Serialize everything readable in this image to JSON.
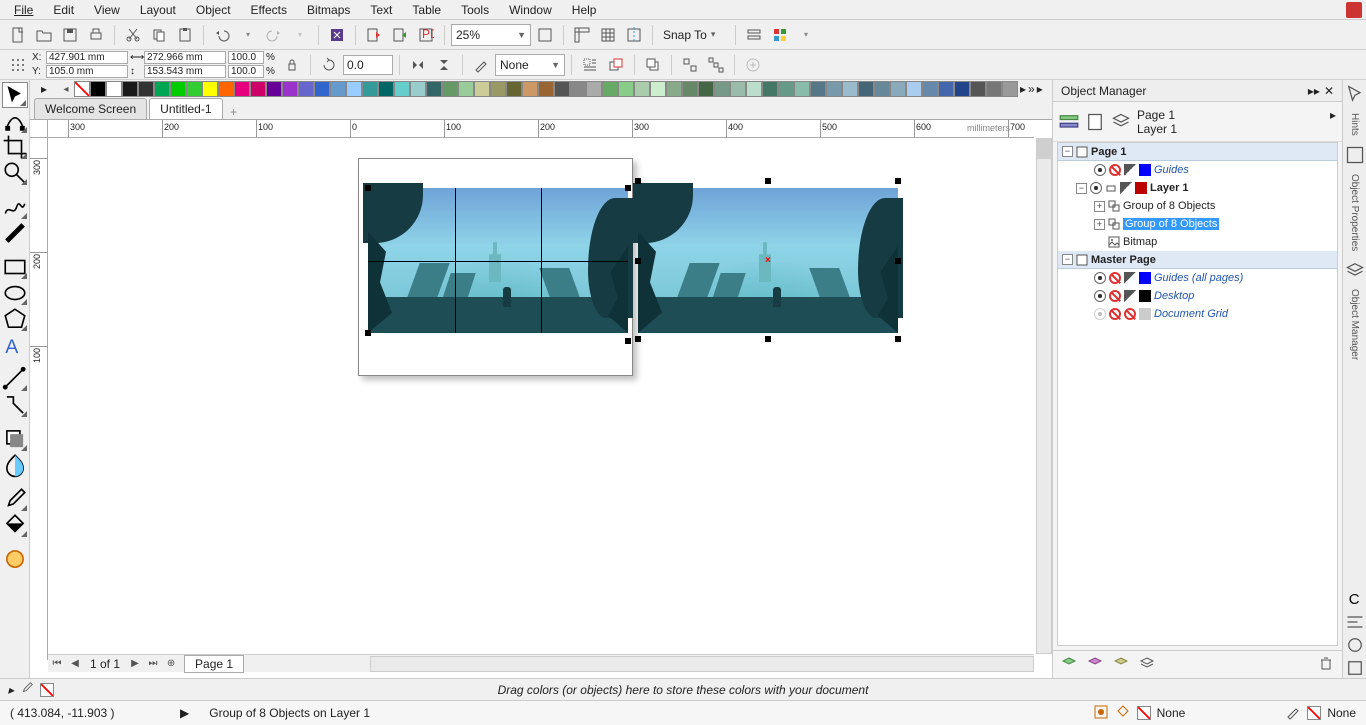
{
  "menu": {
    "items": [
      "File",
      "Edit",
      "View",
      "Layout",
      "Object",
      "Effects",
      "Bitmaps",
      "Text",
      "Table",
      "Tools",
      "Window",
      "Help"
    ]
  },
  "toolbar1": {
    "zoom": "25%",
    "snap": "Snap To"
  },
  "propbar": {
    "x": "427.901 mm",
    "y": "105.0 mm",
    "w": "272.966 mm",
    "h": "153.543 mm",
    "sx": "100.0",
    "sy": "100.0",
    "pct": "%",
    "rot": "0.0",
    "outline": "None"
  },
  "tabs": {
    "welcome": "Welcome Screen",
    "doc": "Untitled-1"
  },
  "ruler_units": "millimeters",
  "hruler_ticks": [
    "300",
    "200",
    "100",
    "0",
    "100",
    "200",
    "300",
    "400",
    "500",
    "600",
    "700"
  ],
  "vruler_ticks": [
    "300",
    "200",
    "100"
  ],
  "pagebar": {
    "counter": "1 of 1",
    "page": "Page 1"
  },
  "docstrip": "Drag colors (or objects) here to store these colors with your document",
  "status": {
    "coord": "( 413.084, -11.903 )",
    "sel": "Group of 8 Objects on Layer 1",
    "fill": "None",
    "outline": "None"
  },
  "panel": {
    "title": "Object Manager",
    "page_label": "Page 1",
    "layer_label": "Layer 1",
    "tree": {
      "page": "Page 1",
      "guides": "Guides",
      "layer": "Layer 1",
      "group1": "Group of 8 Objects",
      "group2": "Group of 8 Objects",
      "bitmap": "Bitmap",
      "master": "Master Page",
      "guides_all": "Guides (all pages)",
      "desktop": "Desktop",
      "docgrid": "Document Grid"
    }
  },
  "sidedock": {
    "hints": "Hints",
    "objprop": "Object Properties",
    "objmgr": "Object Manager"
  },
  "palette": [
    "#000000",
    "#ffffff",
    "#f0f0f0",
    "#d9d9d9",
    "#030303",
    "#00a651",
    "#33cc33",
    "#ffff00",
    "#ff6600",
    "#e6007e",
    "#cc0066",
    "#660099",
    "#9933cc",
    "#6666cc",
    "#3366cc",
    "#6699cc",
    "#99ccff",
    "#339999",
    "#006666",
    "#66cccc",
    "#99cccc",
    "#336666",
    "#669966",
    "#99cc99",
    "#cccc99",
    "#999966",
    "#666633",
    "#808080",
    "#4d4d4d",
    "#333333"
  ]
}
